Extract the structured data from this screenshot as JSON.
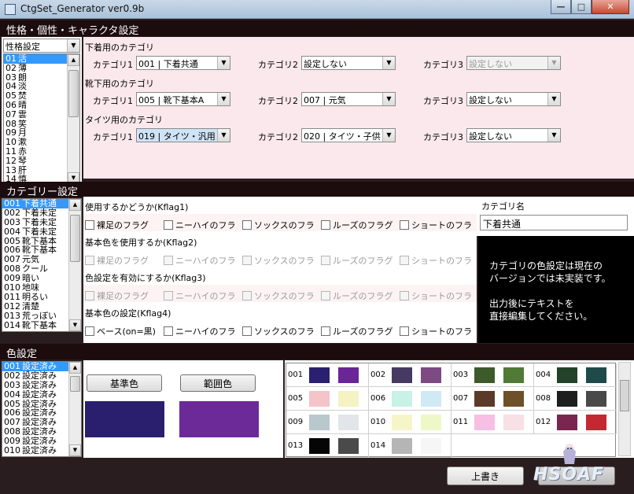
{
  "window": {
    "title": "CtgSet_Generator ver0.9b",
    "minimize": "—",
    "maximize": "□",
    "close": "✕"
  },
  "sections": {
    "personality": "性格・個性・キャラクタ設定",
    "category": "カテゴリー設定",
    "color": "色設定"
  },
  "personality_list": {
    "combo_value": "性格設定",
    "items": [
      {
        "num": "01",
        "label": "活"
      },
      {
        "num": "02",
        "label": "薄"
      },
      {
        "num": "03",
        "label": "朗"
      },
      {
        "num": "04",
        "label": "淡"
      },
      {
        "num": "05",
        "label": "焚"
      },
      {
        "num": "06",
        "label": "晴"
      },
      {
        "num": "07",
        "label": "雲"
      },
      {
        "num": "08",
        "label": "笑"
      },
      {
        "num": "09",
        "label": "月"
      },
      {
        "num": "10",
        "label": "漱"
      },
      {
        "num": "11",
        "label": "赤"
      },
      {
        "num": "12",
        "label": "琴"
      },
      {
        "num": "13",
        "label": "肝"
      },
      {
        "num": "14",
        "label": "慎"
      }
    ]
  },
  "category_groups": [
    {
      "title": "下着用のカテゴリ",
      "cat1_label": "カテゴリ1",
      "cat1": "001 | 下着共通",
      "cat2_label": "カテゴリ2",
      "cat2": "設定しない",
      "cat3_label": "カテゴリ3",
      "cat3": "設定しない"
    },
    {
      "title": "靴下用のカテゴリ",
      "cat1_label": "カテゴリ1",
      "cat1": "005 | 靴下基本A",
      "cat2_label": "カテゴリ2",
      "cat2": "007 | 元気",
      "cat3_label": "カテゴリ3",
      "cat3": "設定しない"
    },
    {
      "title": "タイツ用のカテゴリ",
      "cat1_label": "カテゴリ1",
      "cat1": "019 | タイツ・汎用",
      "cat2_label": "カテゴリ2",
      "cat2": "020 | タイツ・子供",
      "cat3_label": "カテゴリ3",
      "cat3": "設定しない"
    }
  ],
  "category_list": {
    "items": [
      {
        "num": "001",
        "label": "下着共通"
      },
      {
        "num": "002",
        "label": "下着未定"
      },
      {
        "num": "003",
        "label": "下着未定"
      },
      {
        "num": "004",
        "label": "下着未定"
      },
      {
        "num": "005",
        "label": "靴下基本"
      },
      {
        "num": "006",
        "label": "靴下基本"
      },
      {
        "num": "007",
        "label": "元気"
      },
      {
        "num": "008",
        "label": "クール"
      },
      {
        "num": "009",
        "label": "暗い"
      },
      {
        "num": "010",
        "label": "地味"
      },
      {
        "num": "011",
        "label": "明るい"
      },
      {
        "num": "012",
        "label": "清楚"
      },
      {
        "num": "013",
        "label": "荒っぽい"
      },
      {
        "num": "014",
        "label": "靴下基本"
      }
    ]
  },
  "flags": {
    "kflag1": {
      "title": "使用するかどうか(Kflag1)",
      "options": [
        "裸足のフラグ",
        "ニーハイのフラ",
        "ソックスのフラ",
        "ルーズのフラグ",
        "ショートのフラ"
      ]
    },
    "kflag2": {
      "title": "基本色を使用するか(Kflag2)",
      "options": [
        "裸足のフラグ",
        "ニーハイのフラ",
        "ソックスのフラ",
        "ルーズのフラグ",
        "ショートのフラ"
      ]
    },
    "kflag3": {
      "title": "色設定を有効にするか(Kflag3)",
      "options": [
        "裸足のフラグ",
        "ニーハイのフラ",
        "ソックスのフラ",
        "ルーズのフラグ",
        "ショートのフラ"
      ]
    },
    "kflag4": {
      "title": "基本色の設定(Kflag4)",
      "options": [
        "ベース(on=黒)",
        "ニーハイのフラ",
        "ソックスのフラ",
        "ルーズのフラグ",
        "ショートのフラ"
      ]
    }
  },
  "category_name": {
    "label": "カテゴリ名",
    "value": "下着共通"
  },
  "notice": {
    "line1": "カテゴリの色設定は現在の",
    "line2": "バージョンでは未実装です。",
    "line3": "出力後にテキストを",
    "line4": "直接編集してください。"
  },
  "color_list": {
    "items": [
      {
        "num": "001",
        "label": "設定済み"
      },
      {
        "num": "002",
        "label": "設定済み"
      },
      {
        "num": "003",
        "label": "設定済み"
      },
      {
        "num": "004",
        "label": "設定済み"
      },
      {
        "num": "005",
        "label": "設定済み"
      },
      {
        "num": "006",
        "label": "設定済み"
      },
      {
        "num": "007",
        "label": "設定済み"
      },
      {
        "num": "008",
        "label": "設定済み"
      },
      {
        "num": "009",
        "label": "設定済み"
      },
      {
        "num": "010",
        "label": "設定済み"
      }
    ]
  },
  "color_buttons": {
    "base": "基準色",
    "range": "範囲色"
  },
  "color_preview": {
    "base": "#2a1f6e",
    "range": "#6c2a98"
  },
  "palette": [
    {
      "num": "001",
      "c1": "#2b2070",
      "c2": "#6a2596"
    },
    {
      "num": "002",
      "c1": "#463a62",
      "c2": "#7e4a83"
    },
    {
      "num": "003",
      "c1": "#3e5a2a",
      "c2": "#517a36"
    },
    {
      "num": "004",
      "c1": "#24422a",
      "c2": "#1f4a4a"
    },
    {
      "num": "005",
      "c1": "#f5c4c8",
      "c2": "#f5f2c4"
    },
    {
      "num": "006",
      "c1": "#c8f2e6",
      "c2": "#cfeaf5"
    },
    {
      "num": "007",
      "c1": "#5b3a28",
      "c2": "#6e5128"
    },
    {
      "num": "008",
      "c1": "#1e1e1e",
      "c2": "#494949"
    },
    {
      "num": "009",
      "c1": "#b8c8cc",
      "c2": "#e2e6ea"
    },
    {
      "num": "010",
      "c1": "#f6f5c8",
      "c2": "#eef7c6"
    },
    {
      "num": "011",
      "c1": "#f6bfe3",
      "c2": "#f7e0e6"
    },
    {
      "num": "012",
      "c1": "#7a2650",
      "c2": "#c42830"
    },
    {
      "num": "013",
      "c1": "#050505",
      "c2": "#4a4a4a"
    },
    {
      "num": "014",
      "c1": "#b5b5b5",
      "c2": "#f6f6f6"
    }
  ],
  "overwrite_button": "上書き",
  "watermark": "HSOAF"
}
